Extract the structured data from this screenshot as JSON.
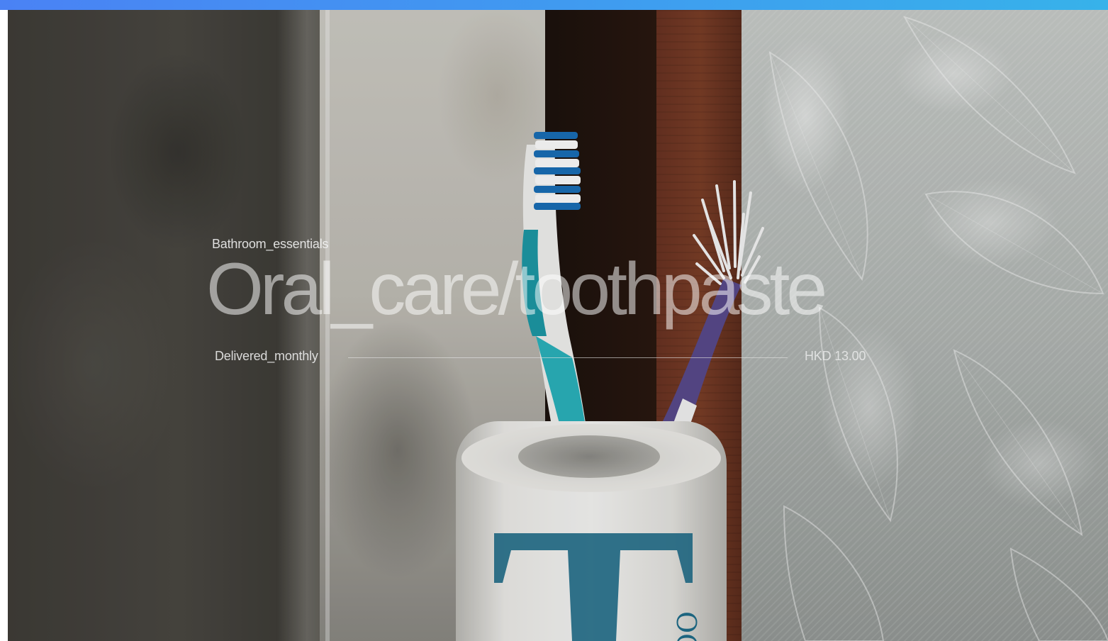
{
  "product": {
    "category": "Bathroom_essentials",
    "title": "Oral_care/toothpaste",
    "frequency": "Delivered_monthly",
    "price": "HKD 13.00"
  },
  "hero_image": {
    "description_icon": "toothbrushes-in-holder-photo"
  },
  "colors": {
    "top_bar_start": "#4a82f4",
    "top_bar_end": "#37b2ea",
    "text": "#ffffff"
  }
}
